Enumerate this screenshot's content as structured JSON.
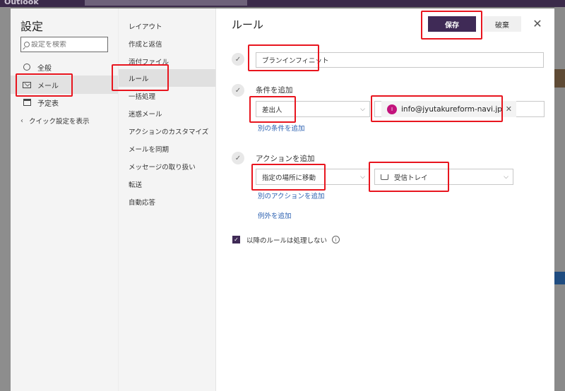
{
  "app": {
    "name": "Outlook"
  },
  "settings": {
    "title": "設定",
    "search_placeholder": "設定を検索",
    "nav": [
      {
        "label": "全般",
        "icon": "gear-icon"
      },
      {
        "label": "メール",
        "icon": "mail-icon",
        "active": true
      },
      {
        "label": "予定表",
        "icon": "calendar-icon"
      }
    ],
    "quick_settings_link": "クイック設定を表示"
  },
  "mail_nav": [
    {
      "label": "レイアウト"
    },
    {
      "label": "作成と返信"
    },
    {
      "label": "添付ファイル"
    },
    {
      "label": "ルール",
      "active": true
    },
    {
      "label": "一括処理"
    },
    {
      "label": "迷惑メール"
    },
    {
      "label": "アクションのカスタマイズ"
    },
    {
      "label": "メールを同期"
    },
    {
      "label": "メッセージの取り扱い"
    },
    {
      "label": "転送"
    },
    {
      "label": "自動応答"
    }
  ],
  "rules": {
    "title": "ルール",
    "save_label": "保存",
    "discard_label": "破棄",
    "rule_name": "ブランインフィニット",
    "condition_heading": "条件を追加",
    "condition_type": "差出人",
    "condition_value": "info@jyutakureform-navi.jp",
    "condition_avatar": "I",
    "add_condition_link": "別の条件を追加",
    "action_heading": "アクションを追加",
    "action_type": "指定の場所に移動",
    "action_folder": "受信トレイ",
    "add_action_link": "別のアクションを追加",
    "add_exception_link": "例外を追加",
    "stop_processing_label": "以降のルールは処理しない",
    "stop_processing_checked": true
  },
  "colors": {
    "accent": "#3f2a56",
    "highlight": "#e8151e",
    "link": "#2a5fb0"
  }
}
